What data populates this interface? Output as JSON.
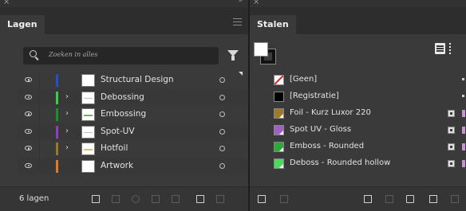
{
  "layers_panel": {
    "title": "Lagen",
    "search_placeholder": "Zoeken in alles",
    "count_label": "6 lagen",
    "layers": [
      {
        "name": "Structural Design",
        "color": "#2a4fc4",
        "expandable": false,
        "thumb_line": ""
      },
      {
        "name": "Debossing",
        "color": "#36d04a",
        "expandable": true,
        "thumb_line": "#bdbdbd"
      },
      {
        "name": "Embossing",
        "color": "#1f8e2a",
        "expandable": true,
        "thumb_line": "#6db36d"
      },
      {
        "name": "Spot-UV",
        "color": "#8d3fc3",
        "expandable": true,
        "thumb_line": "#bdbdbd"
      },
      {
        "name": "Hotfoil",
        "color": "#9a7a2a",
        "expandable": true,
        "thumb_line": "#d6c36b"
      },
      {
        "name": "Artwork",
        "color": "#e07a2a",
        "expandable": false,
        "thumb_line": ""
      }
    ],
    "bottom_icons": [
      "make-clipping-mask-icon",
      "collect-icon",
      "locate-object-icon",
      "link-icon",
      "convert-icon",
      "new-sublayer-icon",
      "new-layer-icon",
      "delete-icon"
    ]
  },
  "swatches_panel": {
    "title": "Stalen",
    "swatches": [
      {
        "name": "[Geen]",
        "color": "none",
        "type": "none"
      },
      {
        "name": "[Registratie]",
        "color": "#000000",
        "type": "registration"
      },
      {
        "name": "Foil - Kurz Luxor 220",
        "color": "#9c7b2c",
        "type": "spot"
      },
      {
        "name": "Spot UV - Gloss",
        "color": "#a060c8",
        "type": "spot"
      },
      {
        "name": "Emboss - Rounded",
        "color": "#2fa83a",
        "type": "spot"
      },
      {
        "name": "Deboss - Rounded hollow",
        "color": "#4fd860",
        "type": "spot"
      }
    ],
    "bottom_icons": [
      "library-icon",
      "place-swatch-icon",
      "color-group-icon",
      "folder-icon",
      "new-swatch-icon",
      "delete-icon"
    ]
  }
}
